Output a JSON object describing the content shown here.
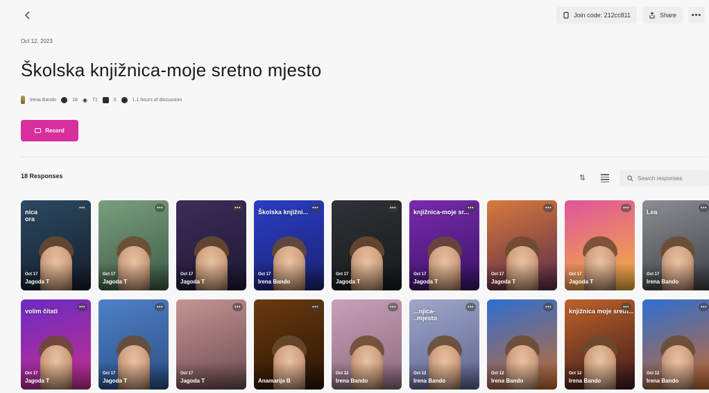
{
  "header": {
    "join_code_label": "Join code: 212cc811",
    "share_label": "Share"
  },
  "topic": {
    "date": "Oct 12, 2023",
    "title": "Školska knjižnica-moje sretno mjesto",
    "owner": "Irena Bando",
    "stats": {
      "responses": "18",
      "views": "71",
      "comments": "0",
      "discussion": "1.1 hours of discussion"
    }
  },
  "record_button": {
    "label": "Record"
  },
  "responses": {
    "count_label": "18 Responses",
    "search_placeholder": "Search responses",
    "cards": [
      {
        "date": "Oct 17",
        "name": "Jagoda T",
        "overlay": "nica\nora",
        "bg": "#2b4a63,#151d2b",
        "face": true
      },
      {
        "date": "Oct 17",
        "name": "Jagoda T",
        "overlay": "",
        "bg": "#7a9e7f,#3d5a44",
        "face": true
      },
      {
        "date": "Oct 17",
        "name": "Jagoda T",
        "overlay": "",
        "bg": "#3c2d58,#1f1733",
        "face": true
      },
      {
        "date": "Oct 17",
        "name": "Irena Bando",
        "overlay": "Školska knjižni...",
        "bg": "#2a3ec4,#1b2273",
        "face": true
      },
      {
        "date": "Oct 17",
        "name": "Jagoda T",
        "overlay": "",
        "bg": "#2f3236,#17191b",
        "face": true
      },
      {
        "date": "Oct 17",
        "name": "Jagoda T",
        "overlay": "knjižnica-moje sr...",
        "bg": "#7a2ab0,#3a1464",
        "face": true
      },
      {
        "date": "Oct 17",
        "name": "Jagoda T",
        "overlay": "",
        "bg": "#d77a3c,#5a2a4a",
        "face": true
      },
      {
        "date": "Oct 17",
        "name": "Jagoda T",
        "overlay": "",
        "bg": "#e0549b,#f3b43a",
        "face": true
      },
      {
        "date": "Oct 17",
        "name": "Irena Bando",
        "overlay": "Lea",
        "bg": "#8b8f93,#3c3f44",
        "face": true
      },
      {
        "date": "Oct 17",
        "name": "Jagoda T",
        "overlay": "volim čitati",
        "bg": "#6a2bc2,#c7308e",
        "face": true
      },
      {
        "date": "Oct 17",
        "name": "Jagoda T",
        "overlay": "",
        "bg": "#4f80c7,#2b4f86",
        "face": true
      },
      {
        "date": "Oct 17",
        "name": "Jagoda T",
        "overlay": "",
        "bg": "#c49494,#6d4b51",
        "face": false
      },
      {
        "date": "",
        "name": "Anamarija B",
        "overlay": "",
        "bg": "#6b3a0f,#2a1404",
        "face": true
      },
      {
        "date": "Oct 12",
        "name": "Irena Bando",
        "overlay": "",
        "bg": "#c9a0b8,#8a6a7c",
        "face": true
      },
      {
        "date": "Oct 12",
        "name": "Irena Bando",
        "overlay": "...njica-\n..mjesto",
        "bg": "#9fa7c9,#5d6390",
        "face": true
      },
      {
        "date": "Oct 12",
        "name": "Irena Bando",
        "overlay": "",
        "bg": "#2e6fd1,#c86a2d",
        "face": true
      },
      {
        "date": "Oct 12",
        "name": "Irena Bando",
        "overlay": "knjižnica moje sretn...",
        "bg": "#c0622a,#3a1a1c",
        "face": true
      },
      {
        "date": "Oct 12",
        "name": "Irena Bando",
        "overlay": "",
        "bg": "#2e6fd1,#c86a2d",
        "face": true
      }
    ]
  }
}
